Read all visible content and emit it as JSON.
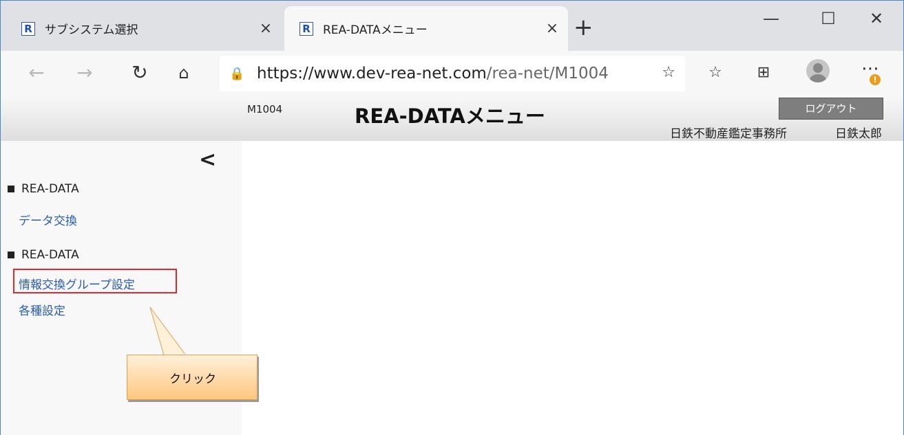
{
  "browser": {
    "tabs": [
      {
        "title": "サブシステム選択",
        "favicon": "R"
      },
      {
        "title": "REA-DATAメニュー",
        "favicon": "R"
      }
    ],
    "tab_close_glyph": "×",
    "new_tab_glyph": "+",
    "address": {
      "host": "https://www.dev-rea-net.com",
      "path": "/rea-net/M1004"
    },
    "badge": "!"
  },
  "header": {
    "screen_id": "M1004",
    "title": "REA-DATAメニュー",
    "logout_label": "ログアウト",
    "office": "日鉄不動産鑑定事務所",
    "user": "日鉄太郎"
  },
  "sidebar": {
    "collapse_glyph": "<",
    "sections": [
      {
        "title": "REA-DATA",
        "items": [
          {
            "label": "データ交換"
          }
        ]
      },
      {
        "title": "REA-DATA",
        "items": [
          {
            "label": "情報交換グループ設定"
          },
          {
            "label": "各種設定"
          }
        ]
      }
    ]
  },
  "callout": {
    "text": "クリック"
  },
  "colors": {
    "link": "#2a5bb8",
    "highlight": "#e0282d",
    "logout_bg": "#7e7e7e",
    "callout": "#ffc680"
  }
}
